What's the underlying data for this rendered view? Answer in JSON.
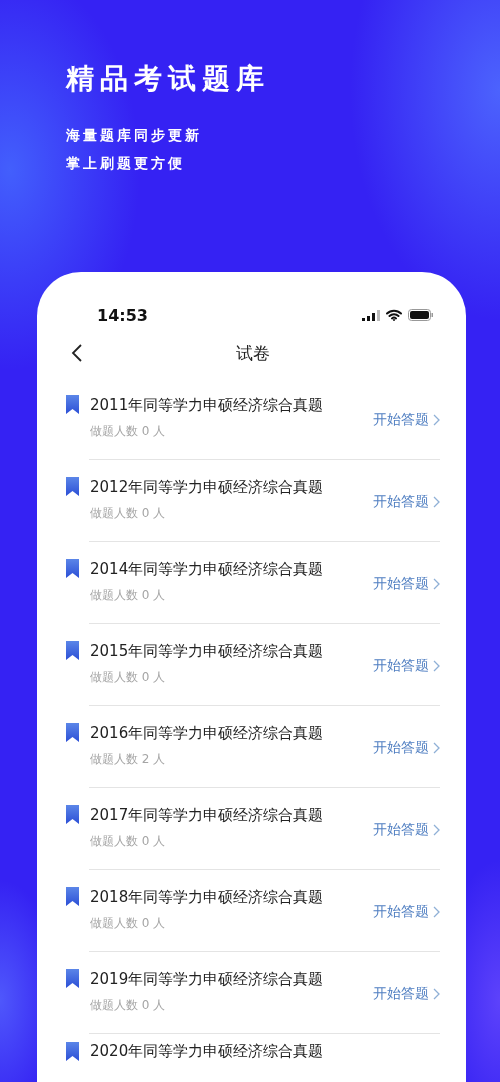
{
  "hero": {
    "title": "精品考试题库",
    "lines": [
      "海量题库同步更新",
      "掌上刷题更方便"
    ]
  },
  "status_bar": {
    "time": "14:53"
  },
  "nav": {
    "title": "试卷"
  },
  "papers": [
    {
      "title": "2011年同等学力申硕经济综合真题",
      "count": "做题人数 0 人",
      "action": "开始答题"
    },
    {
      "title": "2012年同等学力申硕经济综合真题",
      "count": "做题人数 0 人",
      "action": "开始答题"
    },
    {
      "title": "2014年同等学力申硕经济综合真题",
      "count": "做题人数 0 人",
      "action": "开始答题"
    },
    {
      "title": "2015年同等学力申硕经济综合真题",
      "count": "做题人数 0 人",
      "action": "开始答题"
    },
    {
      "title": "2016年同等学力申硕经济综合真题",
      "count": "做题人数 2 人",
      "action": "开始答题"
    },
    {
      "title": "2017年同等学力申硕经济综合真题",
      "count": "做题人数 0 人",
      "action": "开始答题"
    },
    {
      "title": "2018年同等学力申硕经济综合真题",
      "count": "做题人数 0 人",
      "action": "开始答题"
    },
    {
      "title": "2019年同等学力申硕经济综合真题",
      "count": "做题人数 0 人",
      "action": "开始答题"
    },
    {
      "title": "2020年同等学力申硕经济综合真题"
    }
  ]
}
